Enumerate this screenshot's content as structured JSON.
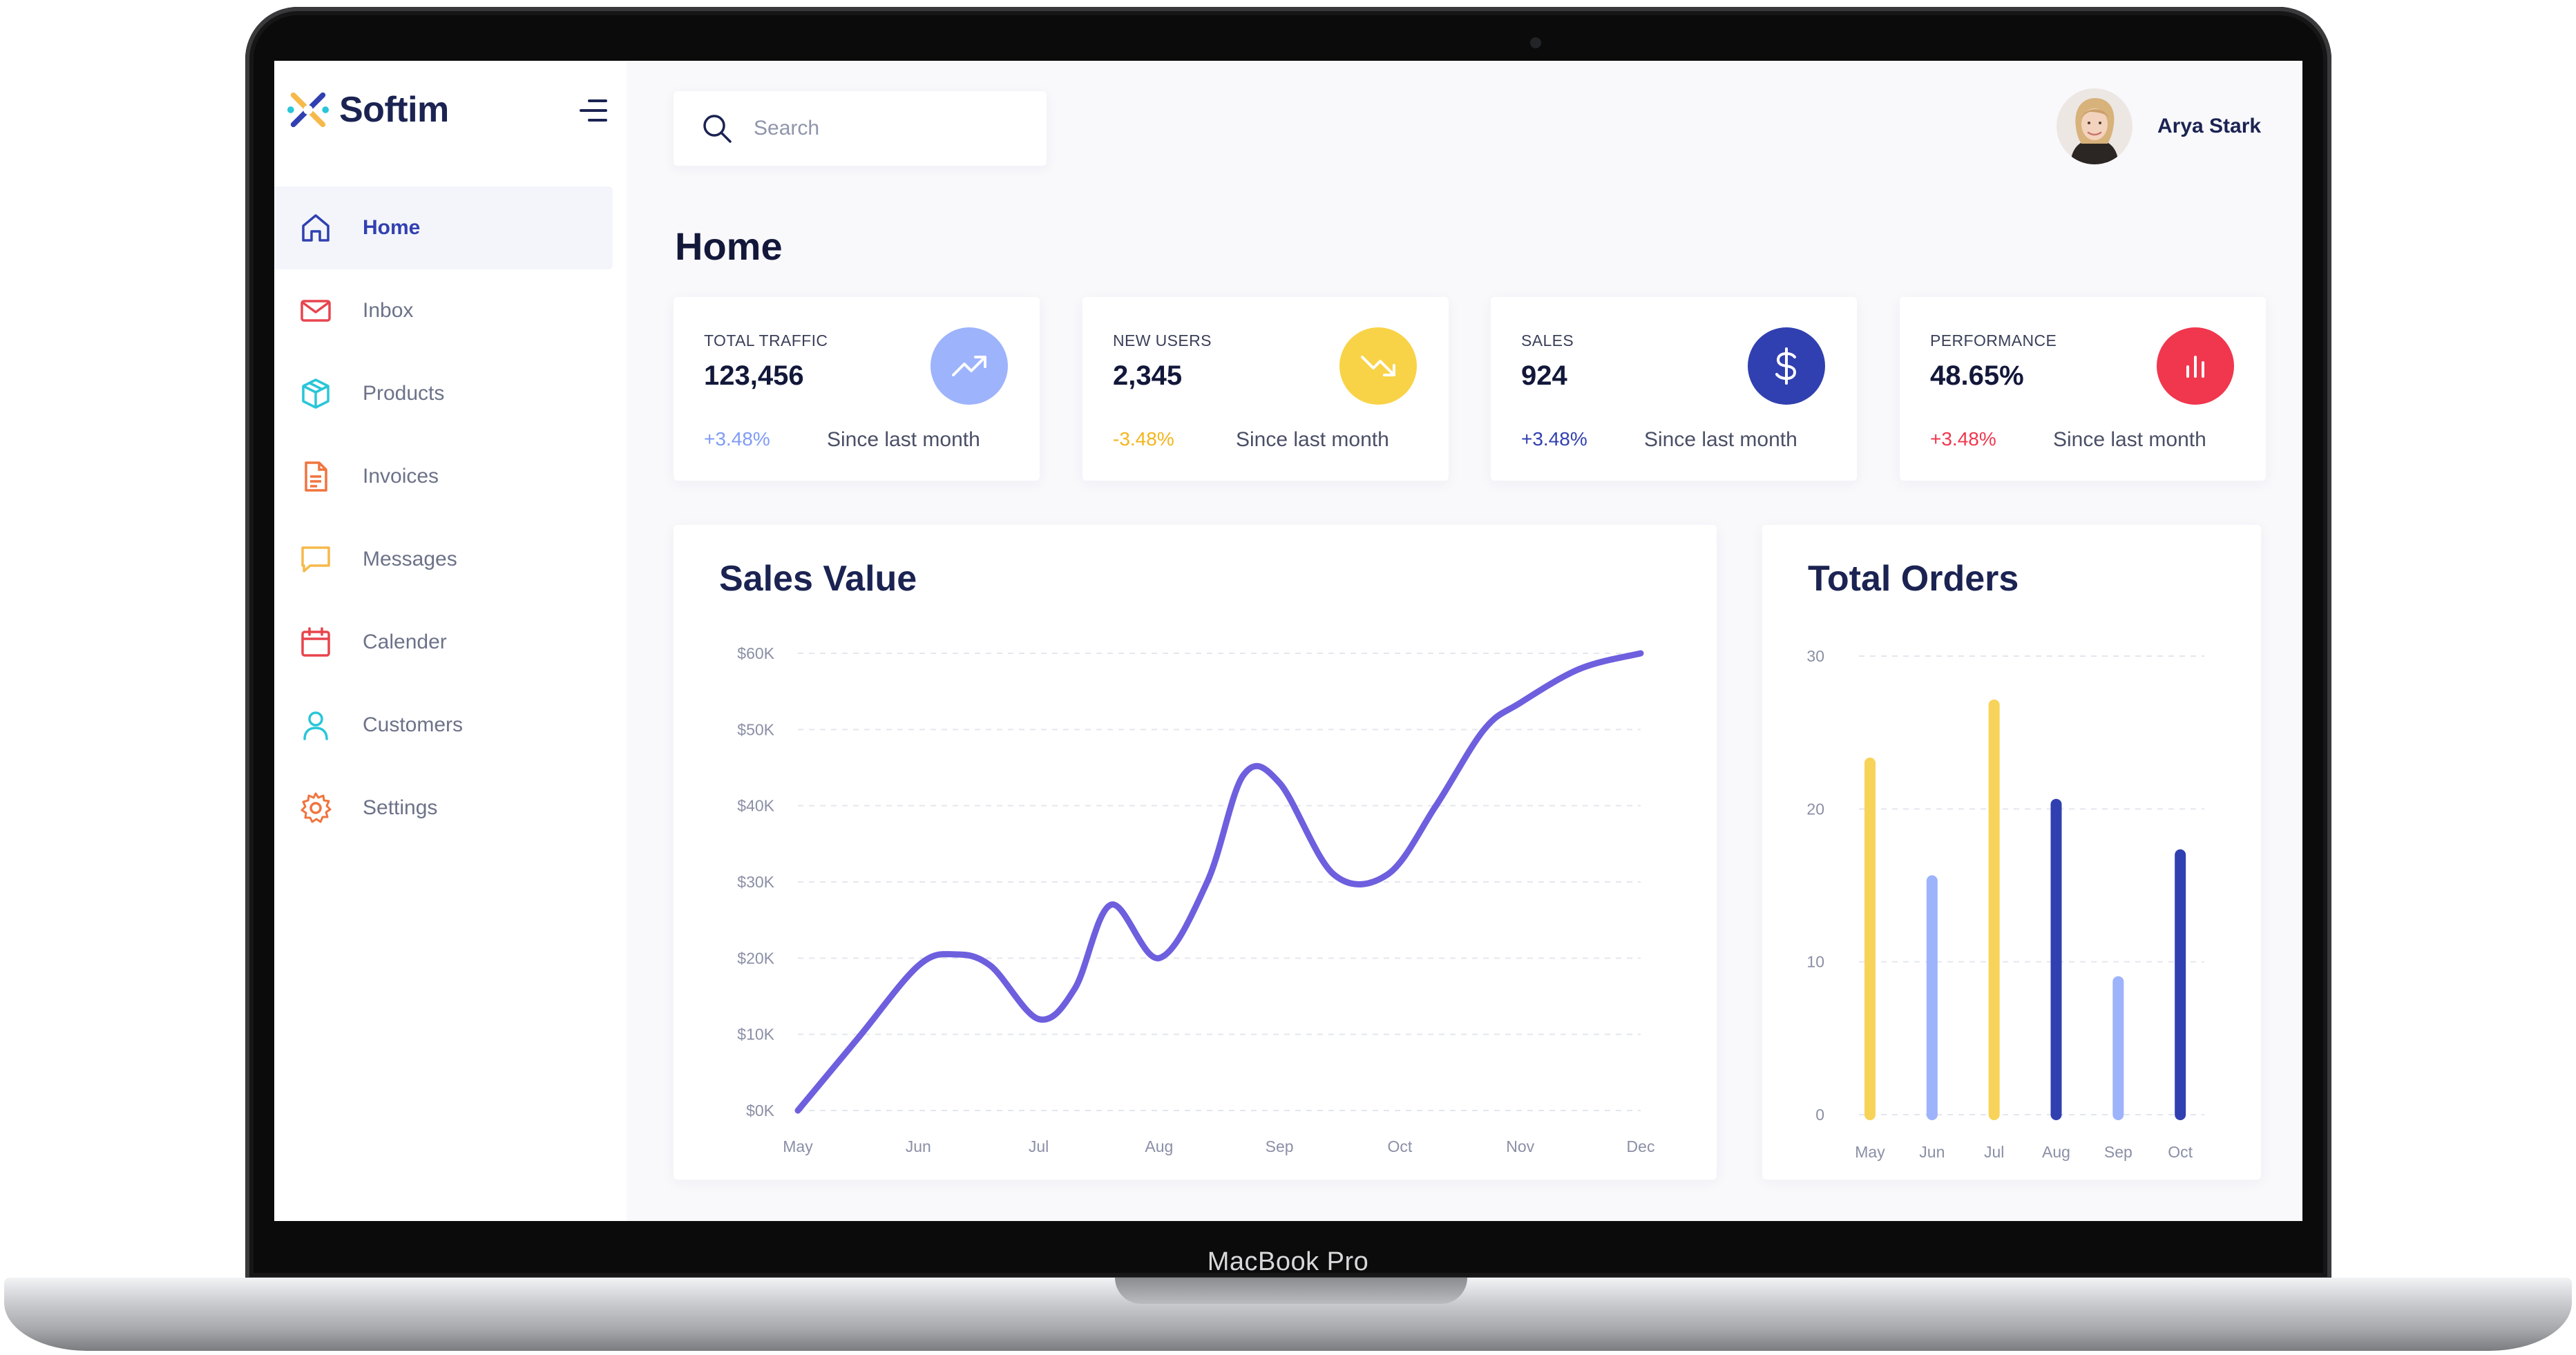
{
  "device": {
    "label": "MacBook Pro"
  },
  "brand": {
    "name": "Softim",
    "logo_icon": "star-cross-logo"
  },
  "sidebar": {
    "items": [
      {
        "label": "Home",
        "icon": "home-icon",
        "color": "#3140b0",
        "active": true
      },
      {
        "label": "Inbox",
        "icon": "mail-icon",
        "color": "#e8444d",
        "active": false
      },
      {
        "label": "Products",
        "icon": "box-icon",
        "color": "#29c6d8",
        "active": false
      },
      {
        "label": "Invoices",
        "icon": "document-icon",
        "color": "#f0743e",
        "active": false
      },
      {
        "label": "Messages",
        "icon": "chat-icon",
        "color": "#f6b94a",
        "active": false
      },
      {
        "label": "Calender",
        "icon": "calendar-icon",
        "color": "#e8444d",
        "active": false
      },
      {
        "label": "Customers",
        "icon": "user-icon",
        "color": "#29c6d8",
        "active": false
      },
      {
        "label": "Settings",
        "icon": "gear-icon",
        "color": "#f0743e",
        "active": false
      }
    ]
  },
  "search": {
    "placeholder": "Search"
  },
  "user": {
    "name": "Arya Stark"
  },
  "page": {
    "title": "Home"
  },
  "stats": [
    {
      "label": "TOTAL TRAFFIC",
      "value": "123,456",
      "change": "+3.48%",
      "since": "Since last month",
      "icon": "trending-up-icon",
      "icon_bg": "#9db3fb",
      "change_color": "#7f9cf5"
    },
    {
      "label": "NEW USERS",
      "value": "2,345",
      "change": "-3.48%",
      "since": "Since last month",
      "icon": "trending-down-icon",
      "icon_bg": "#f8d347",
      "change_color": "#f3b51c"
    },
    {
      "label": "SALES",
      "value": "924",
      "change": "+3.48%",
      "since": "Since last month",
      "icon": "dollar-icon",
      "icon_bg": "#3140b0",
      "change_color": "#3140b0"
    },
    {
      "label": "PERFORMANCE",
      "value": "48.65%",
      "change": "+3.48%",
      "since": "Since last month",
      "icon": "bar-chart-icon",
      "icon_bg": "#f0374e",
      "change_color": "#f0374e"
    }
  ],
  "chart_data": [
    {
      "type": "line",
      "title": "Sales Value",
      "categories": [
        "May",
        "Jun",
        "Jul",
        "Aug",
        "Sep",
        "Oct",
        "Nov",
        "Dec"
      ],
      "x": [
        0,
        0.5,
        1,
        1.3,
        1.6,
        2,
        2.3,
        2.6,
        3,
        3.4,
        3.7,
        4,
        4.45,
        4.9,
        5.3,
        5.7,
        6,
        6.5,
        7
      ],
      "y": [
        0,
        9.5,
        19,
        20.5,
        19,
        12,
        16,
        27,
        20,
        30,
        44,
        43,
        31,
        31,
        40,
        50,
        53.5,
        58,
        60
      ],
      "ylim": [
        0,
        60
      ],
      "yticks": [
        "$0K",
        "$10K",
        "$20K",
        "$30K",
        "$40K",
        "$50K",
        "$60K"
      ],
      "line_color": "#6e5fde",
      "grid": "horizontal dashed"
    },
    {
      "type": "bar",
      "title": "Total Orders",
      "categories": [
        "May",
        "Jun",
        "Jul",
        "Aug",
        "Sep",
        "Oct"
      ],
      "values": [
        23,
        15.3,
        26.8,
        20.3,
        8.7,
        17
      ],
      "colors": [
        "#f8d35a",
        "#9db3fb",
        "#f8d35a",
        "#3140b0",
        "#9db3fb",
        "#3140b0"
      ],
      "ylim": [
        0,
        30
      ],
      "yticks": [
        "0",
        "10",
        "20",
        "30"
      ],
      "grid": "horizontal dashed"
    }
  ]
}
